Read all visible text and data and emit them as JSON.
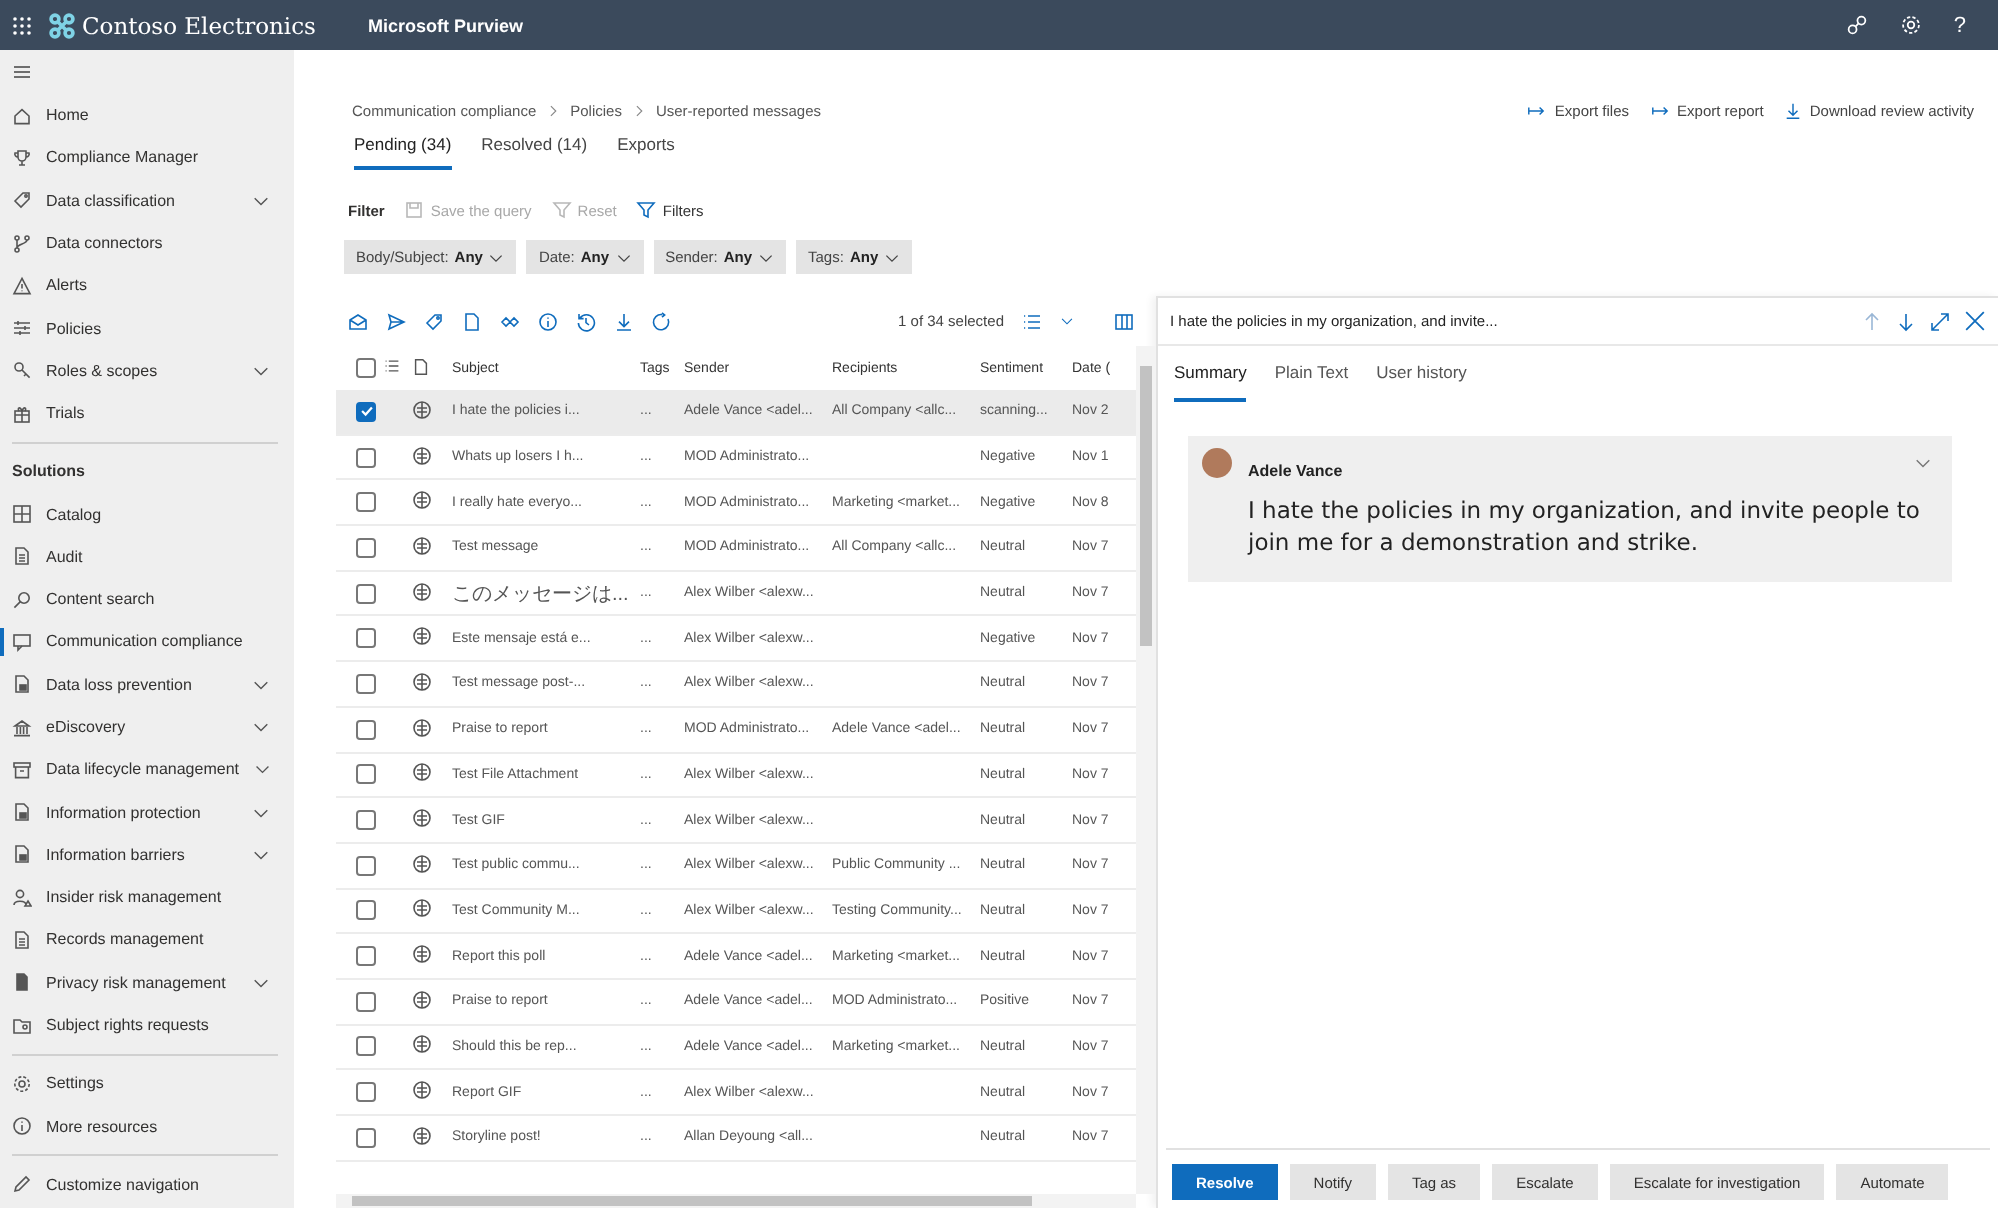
{
  "header": {
    "app_name": "Contoso Electronics",
    "product": "Microsoft Purview",
    "help": "?"
  },
  "nav": {
    "groups": [
      {
        "items": [
          {
            "label": "Home",
            "has_children": false,
            "selected": false
          },
          {
            "label": "Compliance Manager",
            "has_children": false,
            "selected": false
          },
          {
            "label": "Data classification",
            "has_children": true,
            "selected": false
          },
          {
            "label": "Data connectors",
            "has_children": false,
            "selected": false
          },
          {
            "label": "Alerts",
            "has_children": false,
            "selected": false
          },
          {
            "label": "Policies",
            "has_children": false,
            "selected": false
          },
          {
            "label": "Roles & scopes",
            "has_children": true,
            "selected": false
          },
          {
            "label": "Trials",
            "has_children": false,
            "selected": false
          }
        ]
      },
      {
        "heading": "Solutions",
        "items": [
          {
            "label": "Catalog",
            "has_children": false,
            "selected": false
          },
          {
            "label": "Audit",
            "has_children": false,
            "selected": false
          },
          {
            "label": "Content search",
            "has_children": false,
            "selected": false
          },
          {
            "label": "Communication compliance",
            "has_children": false,
            "selected": true
          },
          {
            "label": "Data loss prevention",
            "has_children": true,
            "selected": false
          },
          {
            "label": "eDiscovery",
            "has_children": true,
            "selected": false
          },
          {
            "label": "Data lifecycle management",
            "has_children": true,
            "selected": false
          },
          {
            "label": "Information protection",
            "has_children": true,
            "selected": false
          },
          {
            "label": "Information barriers",
            "has_children": true,
            "selected": false
          },
          {
            "label": "Insider risk management",
            "has_children": false,
            "selected": false
          },
          {
            "label": "Records management",
            "has_children": false,
            "selected": false
          },
          {
            "label": "Privacy risk management",
            "has_children": true,
            "selected": false
          },
          {
            "label": "Subject rights requests",
            "has_children": false,
            "selected": false
          }
        ]
      },
      {
        "items": [
          {
            "label": "Settings",
            "has_children": false,
            "selected": false
          },
          {
            "label": "More resources",
            "has_children": false,
            "selected": false
          }
        ]
      },
      {
        "items": [
          {
            "label": "Customize navigation",
            "has_children": false,
            "selected": false
          }
        ]
      }
    ]
  },
  "breadcrumb": [
    "Communication compliance",
    "Policies",
    "User-reported messages"
  ],
  "export_actions": [
    {
      "label": "Export files",
      "kind": "export"
    },
    {
      "label": "Export report",
      "kind": "export"
    },
    {
      "label": "Download review activity",
      "kind": "download"
    }
  ],
  "tabs": [
    {
      "label": "Pending (34)",
      "selected": true
    },
    {
      "label": "Resolved (14)",
      "selected": false
    },
    {
      "label": "Exports",
      "selected": false
    }
  ],
  "filter": {
    "label": "Filter",
    "actions": [
      {
        "label": "Save the query",
        "kind": "save",
        "disabled": true
      },
      {
        "label": "Reset",
        "kind": "reset",
        "disabled": true
      },
      {
        "label": "Filters",
        "kind": "filters",
        "disabled": false
      }
    ],
    "chips": [
      {
        "name": "Body/Subject:",
        "value": "Any"
      },
      {
        "name": "Date:",
        "value": "Any"
      },
      {
        "name": "Sender:",
        "value": "Any"
      },
      {
        "name": "Tags:",
        "value": "Any"
      }
    ]
  },
  "table": {
    "selection_count": "1 of 34 selected",
    "all_checked": false,
    "columns": [
      "Subject",
      "Tags",
      "Sender",
      "Recipients",
      "Sentiment",
      "Date ("
    ],
    "rows": [
      {
        "selected": true,
        "subject": "I hate the policies i...",
        "tags": "...",
        "sender": "Adele Vance <adel...",
        "recipients": "All Company <allc...",
        "sentiment": "scanning...",
        "date": "Nov 2"
      },
      {
        "selected": false,
        "subject": "Whats up losers I h...",
        "tags": "...",
        "sender": "MOD Administrato...",
        "sentiment": "Negative",
        "date": "Nov 1"
      },
      {
        "selected": false,
        "subject": "I really hate everyo...",
        "tags": "...",
        "sender": "MOD Administrato...",
        "recipients": "Marketing <market...",
        "sentiment": "Negative",
        "date": "Nov 8"
      },
      {
        "selected": false,
        "subject": "Test message",
        "tags": "...",
        "sender": "MOD Administrato...",
        "recipients": "All Company <allc...",
        "sentiment": "Neutral",
        "date": "Nov 7"
      },
      {
        "selected": false,
        "subject": "このメッセージは...",
        "tags": "...",
        "sender": "Alex Wilber <alexw...",
        "sentiment": "Neutral",
        "date": "Nov 7"
      },
      {
        "selected": false,
        "subject": "Este mensaje está e...",
        "tags": "...",
        "sender": "Alex Wilber <alexw...",
        "sentiment": "Negative",
        "date": "Nov 7"
      },
      {
        "selected": false,
        "subject": "Test message post-...",
        "tags": "...",
        "sender": "Alex Wilber <alexw...",
        "sentiment": "Neutral",
        "date": "Nov 7"
      },
      {
        "selected": false,
        "subject": "Praise to report",
        "tags": "...",
        "sender": "MOD Administrato...",
        "recipients": "Adele Vance <adel...",
        "sentiment": "Neutral",
        "date": "Nov 7"
      },
      {
        "selected": false,
        "subject": "Test File Attachment",
        "tags": "...",
        "sender": "Alex Wilber <alexw...",
        "sentiment": "Neutral",
        "date": "Nov 7"
      },
      {
        "selected": false,
        "subject": "Test GIF",
        "tags": "...",
        "sender": "Alex Wilber <alexw...",
        "sentiment": "Neutral",
        "date": "Nov 7"
      },
      {
        "selected": false,
        "subject": "Test public commu...",
        "tags": "...",
        "sender": "Alex Wilber <alexw...",
        "recipients": "Public Community ...",
        "sentiment": "Neutral",
        "date": "Nov 7"
      },
      {
        "selected": false,
        "subject": "Test Community M...",
        "tags": "...",
        "sender": "Alex Wilber <alexw...",
        "recipients": "Testing Community...",
        "sentiment": "Neutral",
        "date": "Nov 7"
      },
      {
        "selected": false,
        "subject": "Report this poll",
        "tags": "...",
        "sender": "Adele Vance <adel...",
        "recipients": "Marketing <market...",
        "sentiment": "Neutral",
        "date": "Nov 7"
      },
      {
        "selected": false,
        "subject": "Praise to report",
        "tags": "...",
        "sender": "Adele Vance <adel...",
        "recipients": "MOD Administrato...",
        "sentiment": "Positive",
        "date": "Nov 7"
      },
      {
        "selected": false,
        "subject": "Should this be rep...",
        "tags": "...",
        "sender": "Adele Vance <adel...",
        "recipients": "Marketing <market...",
        "sentiment": "Neutral",
        "date": "Nov 7"
      },
      {
        "selected": false,
        "subject": "Report GIF",
        "tags": "...",
        "sender": "Alex Wilber <alexw...",
        "sentiment": "Neutral",
        "date": "Nov 7"
      },
      {
        "selected": false,
        "subject": "Storyline post!",
        "tags": "...",
        "sender": "Allan Deyoung <all...",
        "sentiment": "Neutral",
        "date": "Nov 7"
      }
    ]
  },
  "detail": {
    "title": "I hate the policies in my organization, and invite...",
    "tabs": [
      {
        "label": "Summary",
        "selected": true
      },
      {
        "label": "Plain Text",
        "selected": false
      },
      {
        "label": "User history",
        "selected": false
      }
    ],
    "message": {
      "author": "Adele Vance",
      "body": "I hate the policies in my organization, and invite people to join me for a demonstration and strike."
    },
    "actions": [
      {
        "label": "Resolve",
        "kind": "primary"
      },
      {
        "label": "Notify",
        "kind": "default"
      },
      {
        "label": "Tag as",
        "kind": "default"
      },
      {
        "label": "Escalate",
        "kind": "default"
      },
      {
        "label": "Escalate for investigation",
        "kind": "default"
      },
      {
        "label": "Automate",
        "kind": "default"
      }
    ]
  }
}
